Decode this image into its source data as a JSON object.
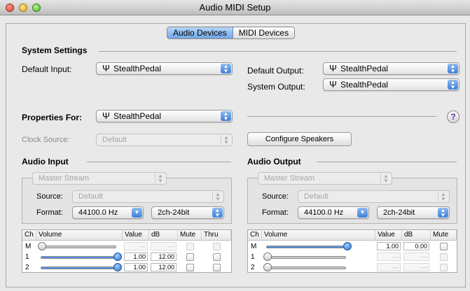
{
  "window": {
    "title": "Audio MIDI Setup"
  },
  "tabs": [
    {
      "label": "Audio Devices",
      "selected": true
    },
    {
      "label": "MIDI Devices",
      "selected": false
    }
  ],
  "system_settings": {
    "header": "System Settings",
    "default_input_label": "Default Input:",
    "default_input_value": "StealthPedal",
    "default_output_label": "Default Output:",
    "default_output_value": "StealthPedal",
    "system_output_label": "System Output:",
    "system_output_value": "StealthPedal"
  },
  "properties": {
    "label": "Properties For:",
    "device": "StealthPedal",
    "help": "?",
    "clock_source_label": "Clock Source:",
    "clock_source_value": "Default",
    "configure_speakers": "Configure Speakers"
  },
  "audio_input": {
    "header": "Audio Input",
    "stream": "Master Stream",
    "source_label": "Source:",
    "source_value": "Default",
    "format_label": "Format:",
    "format_rate": "44100.0 Hz",
    "format_bits": "2ch-24bit",
    "columns": [
      "Ch",
      "Volume",
      "Value",
      "dB",
      "Mute",
      "Thru"
    ],
    "rows": [
      {
        "ch": "M",
        "level": 0.0,
        "value": "—",
        "db": "—",
        "enabled": false
      },
      {
        "ch": "1",
        "level": 1.0,
        "value": "1.00",
        "db": "12.00",
        "enabled": true
      },
      {
        "ch": "2",
        "level": 1.0,
        "value": "1.00",
        "db": "12.00",
        "enabled": true
      }
    ]
  },
  "audio_output": {
    "header": "Audio Output",
    "stream": "Master Stream",
    "source_label": "Source:",
    "source_value": "Default",
    "format_label": "Format:",
    "format_rate": "44100.0 Hz",
    "format_bits": "2ch-24bit",
    "columns": [
      "Ch",
      "Volume",
      "Value",
      "dB",
      "Mute"
    ],
    "rows": [
      {
        "ch": "M",
        "level": 1.0,
        "value": "1.00",
        "db": "0.00",
        "enabled": true
      },
      {
        "ch": "1",
        "level": 0.0,
        "value": "—",
        "db": "—",
        "enabled": false
      },
      {
        "ch": "2",
        "level": 0.0,
        "value": "—",
        "db": "—",
        "enabled": false
      }
    ]
  },
  "colors": {
    "accent": "#3d7fd6",
    "selected_tab": "#6fa6e6"
  },
  "icons": {
    "device": "usb-trident-icon",
    "help": "question-mark-icon"
  }
}
